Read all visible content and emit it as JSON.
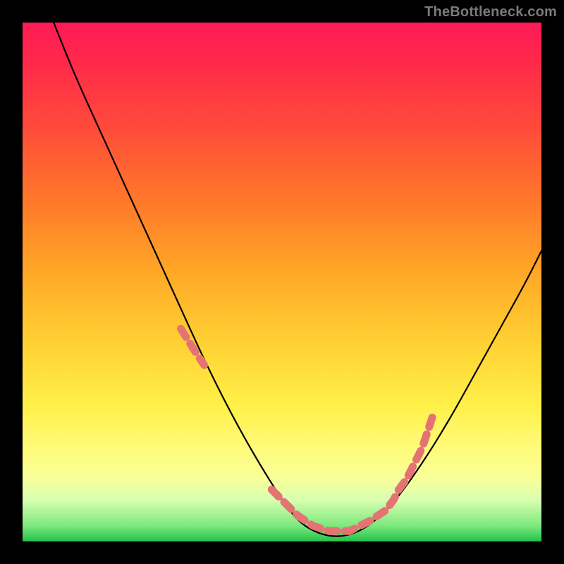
{
  "watermark": {
    "text": "TheBottleneck.com"
  },
  "chart_data": {
    "type": "line",
    "title": "",
    "xlabel": "",
    "ylabel": "",
    "xlim": [
      0,
      100
    ],
    "ylim": [
      0,
      100
    ],
    "grid": false,
    "legend": false,
    "annotations": [],
    "series": [
      {
        "name": "curve",
        "color": "#000000",
        "x": [
          6,
          10,
          15,
          20,
          25,
          30,
          35,
          40,
          45,
          50,
          53,
          56,
          59,
          62,
          65,
          68,
          72,
          77,
          82,
          87,
          92,
          97,
          100
        ],
        "values": [
          100,
          90,
          79,
          68,
          57,
          46,
          35,
          25,
          16,
          8,
          4,
          2,
          1,
          1,
          2,
          4,
          8,
          15,
          23,
          32,
          41,
          50,
          56
        ]
      },
      {
        "name": "dots",
        "color": "#e57373",
        "type": "scatter",
        "x": [
          30.5,
          33,
          35,
          48,
          50,
          53,
          56,
          59,
          61,
          63,
          65,
          67,
          68.5,
          70,
          71.5,
          72.5,
          74,
          76,
          77,
          78,
          79
        ],
        "values": [
          41,
          37,
          34,
          10,
          8,
          5,
          3,
          2,
          2,
          2,
          3,
          4,
          5,
          6,
          8,
          10,
          12,
          16,
          18,
          21,
          24
        ]
      }
    ]
  }
}
